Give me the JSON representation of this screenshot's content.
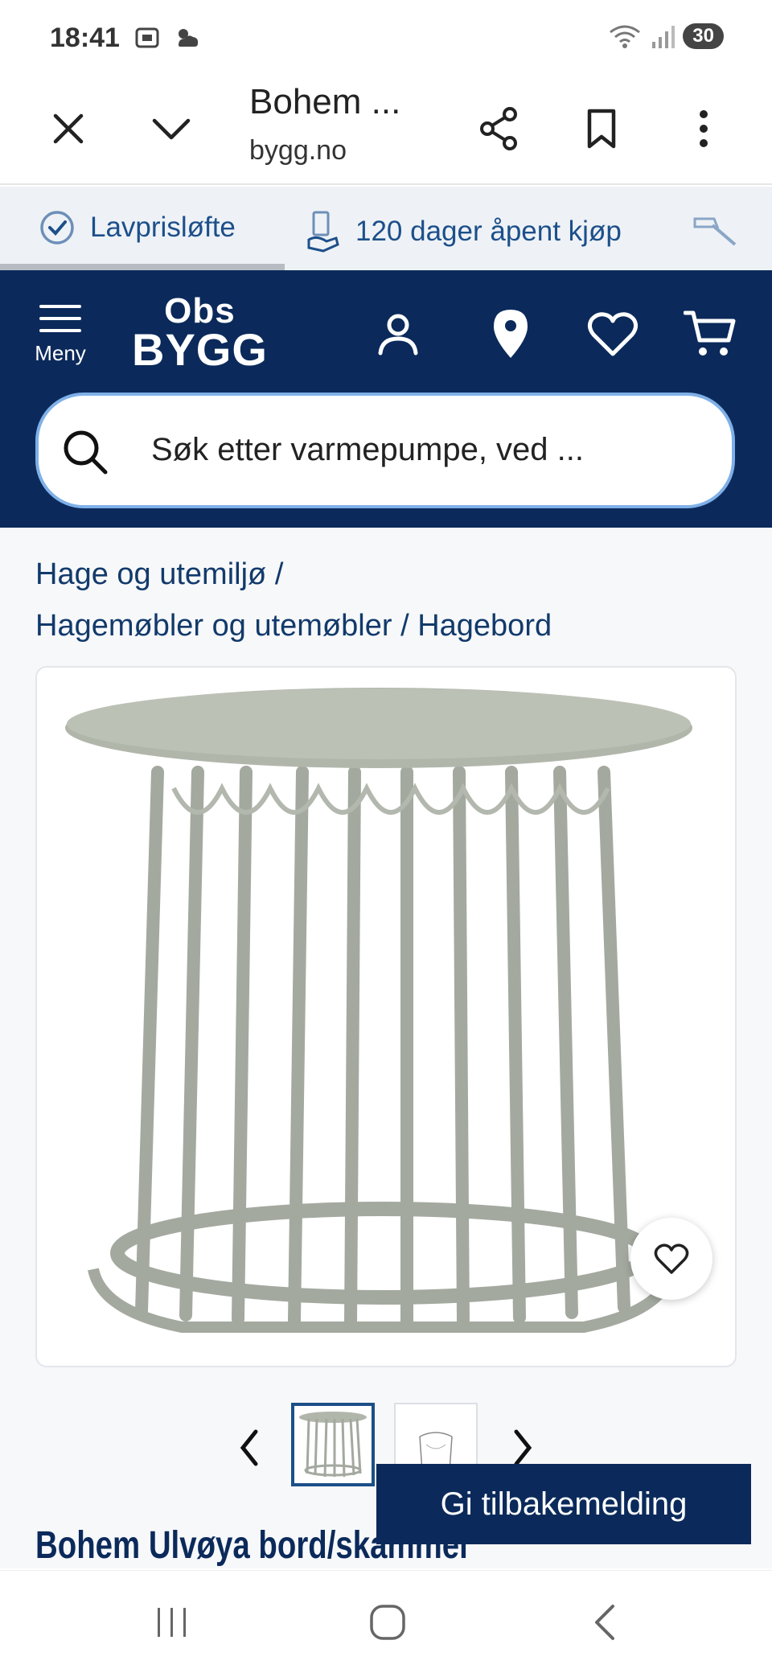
{
  "status_bar": {
    "time": "18:41",
    "battery": "30"
  },
  "browser": {
    "title": "Bohem ...",
    "url": "bygg.no"
  },
  "usp_bar": {
    "items": [
      {
        "label": "Lavprisløfte",
        "icon": "check-circle-icon"
      },
      {
        "label": "120 dager åpent kjøp",
        "icon": "receipt-hand-icon"
      }
    ],
    "third_icon": "hammer-icon"
  },
  "header": {
    "menu_label": "Meny",
    "logo_top": "Obs",
    "logo_bottom": "BYGG"
  },
  "search": {
    "placeholder": "Søk etter varmepumpe, ved ..."
  },
  "breadcrumb": {
    "items": [
      "Hage og utemiljø",
      "Hagemøbler og utemøbler",
      "Hagebord"
    ],
    "separator": "/"
  },
  "product": {
    "title": "Bohem Ulvøya bord/skammel"
  },
  "feedback": {
    "label": "Gi tilbakemelding"
  },
  "colors": {
    "navy": "#0b2a5b",
    "link_blue": "#1d4f8a",
    "table_green": "#a8ada5"
  }
}
